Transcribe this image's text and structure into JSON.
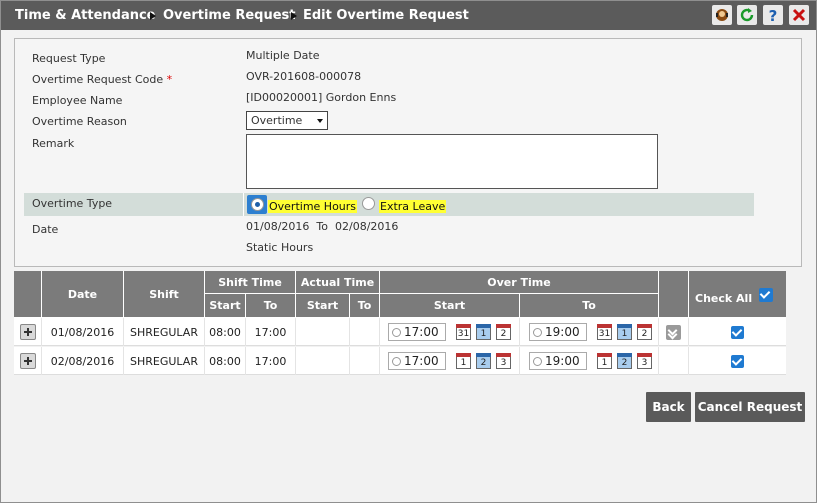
{
  "breadcrumb": {
    "items": [
      "Time & Attendance",
      "Overtime Request",
      "Edit Overtime Request"
    ]
  },
  "toolbar_icons": [
    "user-support-icon",
    "refresh-icon",
    "help-icon",
    "close-icon"
  ],
  "form": {
    "request_type_label": "Request Type",
    "request_type_value": "Multiple Date",
    "request_code_label": "Overtime Request Code",
    "required_mark": "*",
    "request_code_value": "OVR-201608-000078",
    "employee_label": "Employee Name",
    "employee_value": "[ID00020001] Gordon Enns",
    "reason_label": "Overtime Reason",
    "reason_value": "Overtime",
    "remark_label": "Remark",
    "remark_value": "",
    "ot_type_label": "Overtime Type",
    "ot_type_option1": "Overtime Hours",
    "ot_type_option2": "Extra Leave",
    "ot_type_selected": "Overtime Hours",
    "date_label": "Date",
    "date_from": "01/08/2016",
    "date_to_word": "To",
    "date_to": "02/08/2016",
    "hours_mode": "Static Hours"
  },
  "grid": {
    "headers": {
      "date": "Date",
      "shift": "Shift",
      "shift_time": "Shift Time",
      "actual_time": "Actual Time",
      "over_time": "Over Time",
      "check_all": "Check All",
      "start": "Start",
      "to": "To"
    },
    "check_all_checked": true,
    "rows": [
      {
        "date": "01/08/2016",
        "shift": "SHREGULAR",
        "shift_start": "08:00",
        "shift_to": "17:00",
        "actual_start": "",
        "actual_to": "",
        "ot_start": "17:00",
        "ot_start_cal": [
          "31",
          "1",
          "2"
        ],
        "ot_to": "19:00",
        "ot_to_cal": [
          "31",
          "1",
          "2"
        ],
        "checked": true
      },
      {
        "date": "02/08/2016",
        "shift": "SHREGULAR",
        "shift_start": "08:00",
        "shift_to": "17:00",
        "actual_start": "",
        "actual_to": "",
        "ot_start": "17:00",
        "ot_start_cal": [
          "1",
          "2",
          "3"
        ],
        "ot_to": "19:00",
        "ot_to_cal": [
          "1",
          "2",
          "3"
        ],
        "checked": true
      }
    ]
  },
  "actions": {
    "back": "Back",
    "cancel_request": "Cancel Request"
  }
}
